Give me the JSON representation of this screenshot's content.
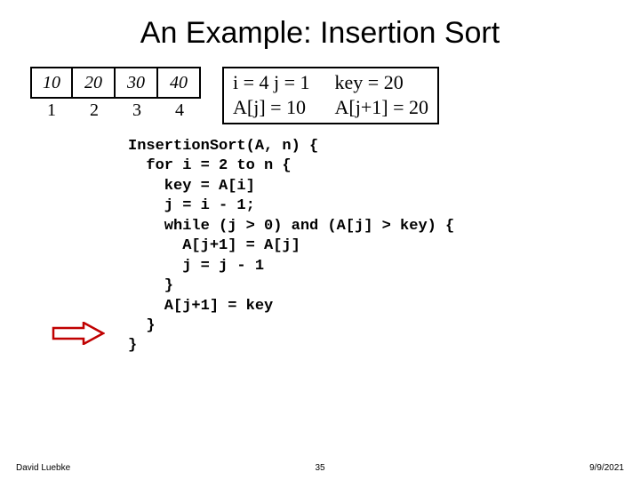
{
  "title": "An Example: Insertion Sort",
  "array": {
    "c0": "10",
    "c1": "20",
    "c2": "30",
    "c3": "40"
  },
  "index": {
    "i0": "1",
    "i1": "2",
    "i2": "3",
    "i3": "4"
  },
  "state": {
    "ij": "i = 4    j = 1",
    "key": "key = 20",
    "aj": "A[j] = 10",
    "aj1": "A[j+1] = 20"
  },
  "code": "InsertionSort(A, n) {\n  for i = 2 to n {\n    key = A[i]\n    j = i - 1;\n    while (j > 0) and (A[j] > key) {\n      A[j+1] = A[j]\n      j = j - 1\n    }\n    A[j+1] = key\n  }\n}",
  "footer": {
    "author": "David Luebke",
    "page": "35",
    "date": "9/9/2021"
  }
}
